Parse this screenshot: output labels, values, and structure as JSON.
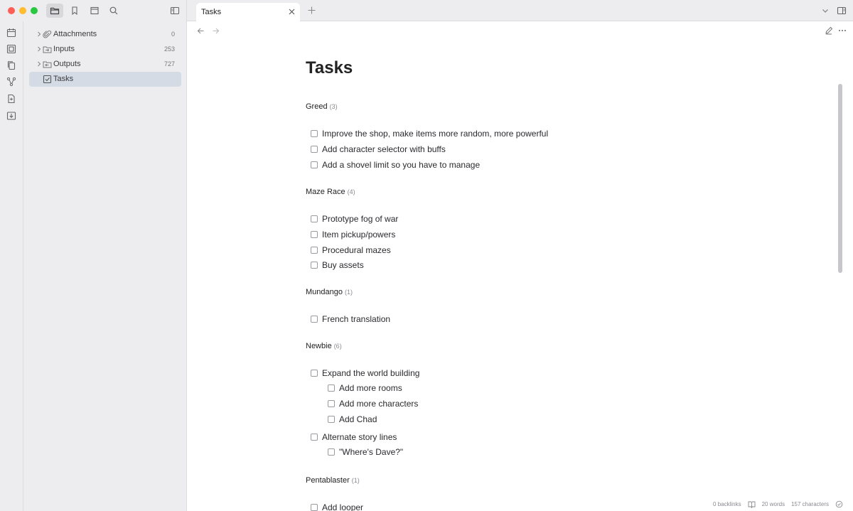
{
  "sidebar": {
    "items": [
      {
        "label": "Attachments",
        "count": "0"
      },
      {
        "label": "Inputs",
        "count": "253"
      },
      {
        "label": "Outputs",
        "count": "727"
      },
      {
        "label": "Tasks",
        "count": ""
      }
    ]
  },
  "tabs": [
    {
      "label": "Tasks"
    }
  ],
  "doc": {
    "title": "Tasks",
    "sections": [
      {
        "name": "Greed",
        "count": "(3)",
        "tasks": [
          "Improve the shop, make items more random, more powerful",
          "Add character selector with buffs",
          "Add a shovel limit so you have to manage"
        ]
      },
      {
        "name": "Maze Race",
        "count": "(4)",
        "tasks": [
          "Prototype fog of war",
          "Item pickup/powers",
          "Procedural mazes",
          "Buy assets"
        ]
      },
      {
        "name": "Mundango",
        "count": "(1)",
        "tasks": [
          "French translation"
        ]
      },
      {
        "name": "Newbie",
        "count": "(6)",
        "tasks": [
          "Expand the world building",
          "Add more rooms",
          "Add more characters",
          "Add Chad",
          "Alternate story lines",
          "\"Where's Dave?\""
        ]
      },
      {
        "name": "Pentablaster",
        "count": "(1)",
        "tasks": [
          "Add looper"
        ]
      }
    ]
  },
  "status": {
    "backlinks": "0 backlinks",
    "words": "20 words",
    "characters": "157 characters"
  },
  "colors": {
    "accent_selected": "#d4dbe5",
    "sidebar_bg": "#ededf0"
  }
}
